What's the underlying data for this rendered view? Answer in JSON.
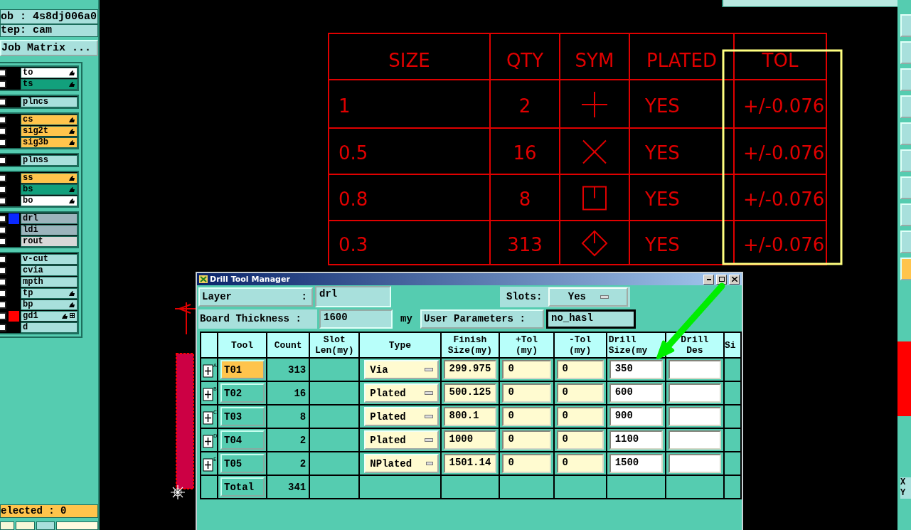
{
  "job_panel": {
    "job": "ob : 4s8dj006a0",
    "step": "tep: cam",
    "job_matrix": "Job Matrix ..."
  },
  "layer_groups": [
    {
      "layers": [
        {
          "name": "to",
          "kind": "silk",
          "pointer": true,
          "checked": false
        },
        {
          "name": "ts",
          "kind": "mask",
          "pointer": true,
          "checked": false
        }
      ]
    },
    {
      "layers": [
        {
          "name": "plncs",
          "kind": "plane",
          "pointer": false,
          "checked": false
        }
      ]
    },
    {
      "layers": [
        {
          "name": "cs",
          "kind": "signal",
          "pointer": true,
          "checked": false
        },
        {
          "name": "sig2t",
          "kind": "signal",
          "pointer": true,
          "checked": false
        },
        {
          "name": "sig3b",
          "kind": "signal",
          "pointer": true,
          "checked": false
        }
      ]
    },
    {
      "layers": [
        {
          "name": "plnss",
          "kind": "plane",
          "pointer": false,
          "checked": false
        }
      ]
    },
    {
      "layers": [
        {
          "name": "ss",
          "kind": "signal",
          "pointer": true,
          "checked": false
        },
        {
          "name": "bs",
          "kind": "mask",
          "pointer": true,
          "checked": false
        },
        {
          "name": "bo",
          "kind": "silk",
          "pointer": true,
          "checked": false
        }
      ]
    },
    {
      "layers": [
        {
          "name": "drl",
          "kind": "drill",
          "color": "#0a28ff",
          "pointer": false,
          "checked": false
        },
        {
          "name": "ldi",
          "kind": "drill",
          "pointer": false,
          "checked": false
        },
        {
          "name": "rout",
          "kind": "rout",
          "pointer": false,
          "checked": false
        }
      ]
    },
    {
      "layers": [
        {
          "name": "v-cut",
          "kind": "document",
          "pointer": false,
          "checked": false
        },
        {
          "name": "cvia",
          "kind": "document",
          "pointer": false,
          "checked": false
        },
        {
          "name": "mpth",
          "kind": "document",
          "pointer": false,
          "checked": false
        },
        {
          "name": "tp",
          "kind": "document",
          "pointer": true,
          "checked": false
        },
        {
          "name": "bp",
          "kind": "document",
          "pointer": true,
          "checked": false
        },
        {
          "name": "gd1",
          "kind": "document",
          "color": "#ff0000",
          "pointer": true,
          "extra": true,
          "checked": false
        },
        {
          "name": "d",
          "kind": "document",
          "pointer": false,
          "checked": false
        }
      ]
    }
  ],
  "selected_bar": "elected : 0",
  "drawing_table": {
    "headers": [
      "SIZE",
      "QTY",
      "SYM",
      "PLATED",
      "TOL"
    ],
    "rows": [
      {
        "size": "1",
        "qty": "2",
        "kind": "plus",
        "plated": "YES",
        "tol": "+/-0.076"
      },
      {
        "size": "0.5",
        "qty": "16",
        "kind": "cross",
        "plated": "YES",
        "tol": "+/-0.076"
      },
      {
        "size": "0.8",
        "qty": "8",
        "kind": "square",
        "plated": "YES",
        "tol": "+/-0.076"
      },
      {
        "size": "0.3",
        "qty": "313",
        "kind": "diamond",
        "plated": "YES",
        "tol": "+/-0.076"
      }
    ]
  },
  "dialog": {
    "title": "Drill Tool Manager",
    "layer": {
      "label": "Layer",
      "colon": ":",
      "value": "drl"
    },
    "slots": {
      "label": "Slots:",
      "value": "Yes"
    },
    "board_thickness": {
      "label": "Board Thickness :",
      "value": "1600",
      "unit": "my"
    },
    "user_parameters": {
      "label": "User Parameters :",
      "value": "no_hasl",
      "focused": true
    },
    "table": {
      "columns": [
        "Tool",
        "Count",
        "Slot\nLen(my)",
        "Type",
        "Finish\nSize(my)",
        "+Tol\n(my)",
        "-Tol\n(my)",
        "Drill\nSize(my",
        "Drill\nDes",
        "Si"
      ],
      "rows": [
        {
          "badge": "A",
          "tool": "T01",
          "selected": true,
          "count": "313",
          "type": "Via",
          "finish": "299.975",
          "plus_tol": "0",
          "minus_tol": "0",
          "drill_size": "350"
        },
        {
          "badge": "B",
          "tool": "T02",
          "selected": false,
          "count": "16",
          "type": "Plated",
          "finish": "500.125",
          "plus_tol": "0",
          "minus_tol": "0",
          "drill_size": "600"
        },
        {
          "badge": "C",
          "tool": "T03",
          "selected": false,
          "count": "8",
          "type": "Plated",
          "finish": "800.1",
          "plus_tol": "0",
          "minus_tol": "0",
          "drill_size": "900"
        },
        {
          "badge": "D",
          "tool": "T04",
          "selected": false,
          "count": "2",
          "type": "Plated",
          "finish": "1000",
          "plus_tol": "0",
          "minus_tol": "0",
          "drill_size": "1100"
        },
        {
          "badge": "E",
          "tool": "T05",
          "selected": false,
          "count": "2",
          "type": "NPlated",
          "finish": "1501.14",
          "plus_tol": "0",
          "minus_tol": "0",
          "drill_size": "1500"
        }
      ],
      "total": {
        "label": "Total",
        "count": "341"
      }
    }
  },
  "right_toolbar": {
    "buttons": [
      {
        "selected": false
      },
      {
        "selected": false
      },
      {
        "selected": false
      },
      {
        "selected": false
      },
      {
        "selected": false
      },
      {
        "selected": false
      },
      {
        "selected": false
      },
      {
        "selected": false
      },
      {
        "selected": false
      },
      {
        "selected": true
      }
    ],
    "coords": [
      "X",
      "Y"
    ]
  }
}
